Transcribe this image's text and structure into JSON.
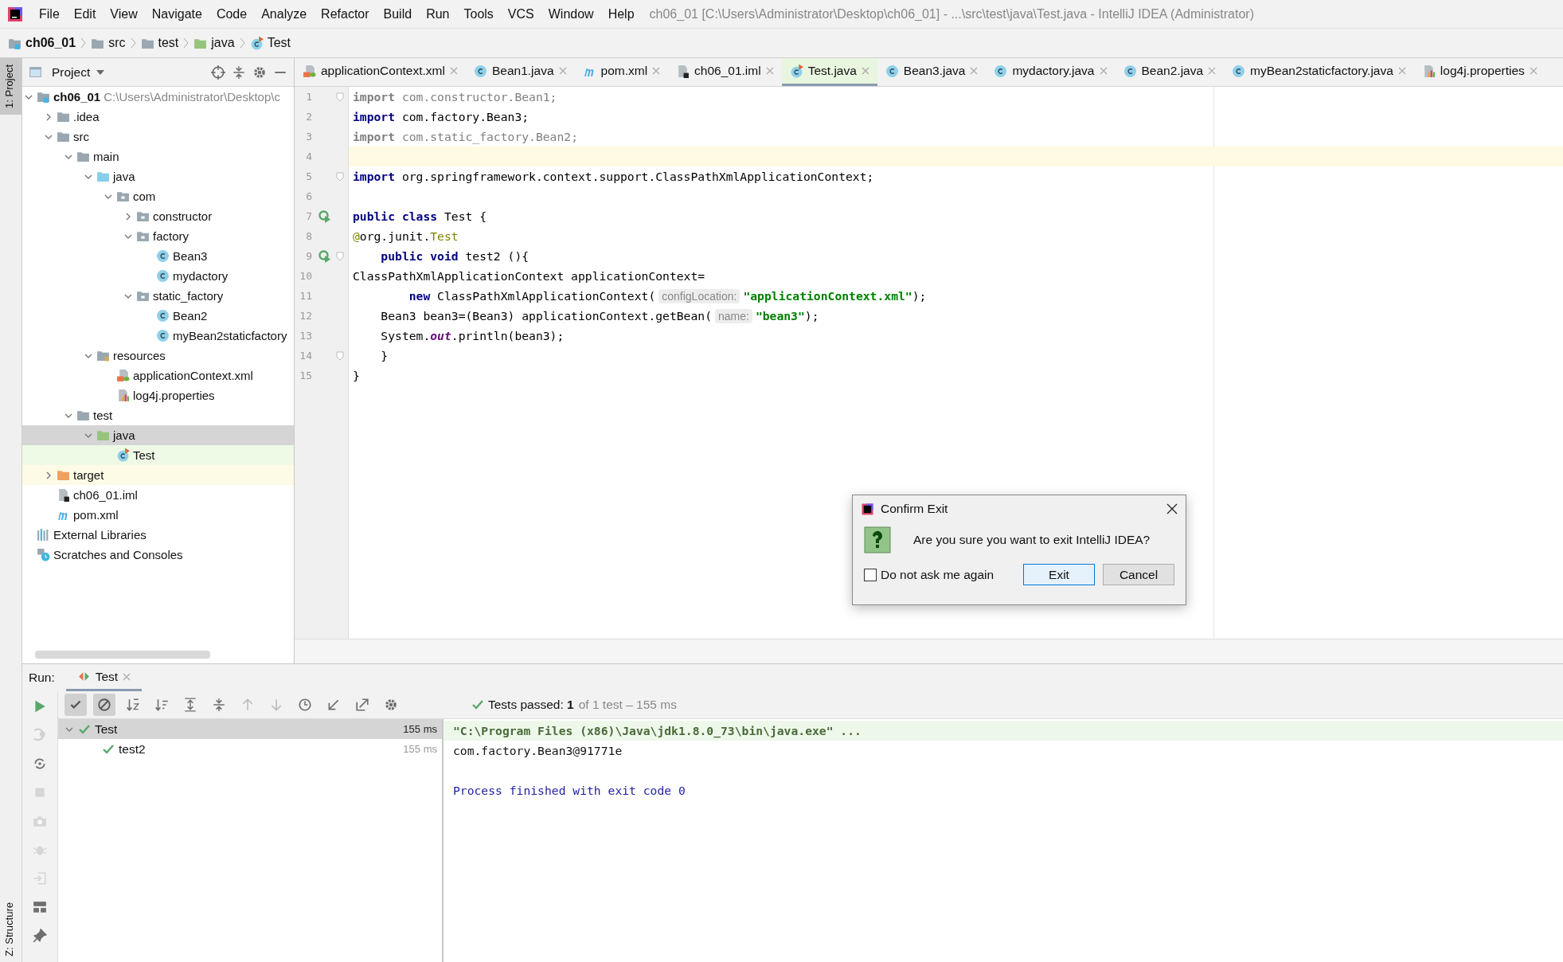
{
  "menu_bar": {
    "items": [
      "File",
      "Edit",
      "View",
      "Navigate",
      "Code",
      "Analyze",
      "Refactor",
      "Build",
      "Run",
      "Tools",
      "VCS",
      "Window",
      "Help"
    ],
    "title": "ch06_01 [C:\\Users\\Administrator\\Desktop\\ch06_01] - ...\\src\\test\\java\\Test.java - IntelliJ IDEA (Administrator)"
  },
  "breadcrumbs": [
    {
      "kind": "module",
      "label": "ch06_01"
    },
    {
      "kind": "folder",
      "label": "src"
    },
    {
      "kind": "folder",
      "label": "test"
    },
    {
      "kind": "test_folder",
      "label": "java"
    },
    {
      "kind": "test_class",
      "label": "Test"
    }
  ],
  "left_stripe": [
    {
      "label": "1: Project",
      "selected": true
    },
    {
      "label": "Z: Structure",
      "selected": false
    }
  ],
  "project_panel": {
    "title": "Project",
    "tree": [
      {
        "kind": "module",
        "name": "ch06_01",
        "path": "C:\\Users\\Administrator\\Desktop\\c",
        "selected": false,
        "expanded": true,
        "children": [
          {
            "kind": "folder",
            "name": ".idea",
            "selected": false,
            "expanded": false
          },
          {
            "kind": "folder",
            "name": "src",
            "selected": false,
            "expanded": true,
            "children": [
              {
                "kind": "folder",
                "name": "main",
                "selected": false,
                "expanded": true,
                "children": [
                  {
                    "kind": "src_folder",
                    "name": "java",
                    "selected": false,
                    "expanded": true,
                    "children": [
                      {
                        "kind": "package",
                        "name": "com",
                        "selected": false,
                        "expanded": true,
                        "children": [
                          {
                            "kind": "package",
                            "name": "constructor",
                            "selected": false,
                            "expanded": false
                          },
                          {
                            "kind": "package",
                            "name": "factory",
                            "selected": false,
                            "expanded": true,
                            "children": [
                              {
                                "kind": "class",
                                "name": "Bean3",
                                "selected": false
                              },
                              {
                                "kind": "class",
                                "name": "mydactory",
                                "selected": false
                              }
                            ]
                          },
                          {
                            "kind": "package",
                            "name": "static_factory",
                            "selected": false,
                            "expanded": true,
                            "children": [
                              {
                                "kind": "class",
                                "name": "Bean2",
                                "selected": false
                              },
                              {
                                "kind": "class",
                                "name": "myBean2staticfactory",
                                "selected": false
                              }
                            ]
                          }
                        ]
                      }
                    ]
                  },
                  {
                    "kind": "res_folder",
                    "name": "resources",
                    "selected": false,
                    "expanded": true,
                    "children": [
                      {
                        "kind": "xml",
                        "name": "applicationContext.xml",
                        "selected": false
                      },
                      {
                        "kind": "properties",
                        "name": "log4j.properties",
                        "selected": false
                      }
                    ]
                  }
                ]
              },
              {
                "kind": "folder",
                "name": "test",
                "selected": false,
                "expanded": true,
                "children": [
                  {
                    "kind": "test_folder",
                    "name": "java",
                    "selected": true,
                    "expanded": true,
                    "children": [
                      {
                        "kind": "test_class",
                        "name": "Test",
                        "selected": false
                      }
                    ]
                  }
                ]
              }
            ]
          },
          {
            "kind": "excluded_folder",
            "name": "target",
            "selected": false,
            "expanded": false
          },
          {
            "kind": "iml",
            "name": "ch06_01.iml",
            "selected": false
          },
          {
            "kind": "maven",
            "name": "pom.xml",
            "selected": false
          }
        ]
      },
      {
        "kind": "libraries",
        "name": "External Libraries",
        "selected": false
      },
      {
        "kind": "scratches",
        "name": "Scratches and Consoles",
        "selected": false
      }
    ]
  },
  "editor_tabs": [
    {
      "kind": "xml",
      "label": "applicationContext.xml",
      "selected": false
    },
    {
      "kind": "class",
      "label": "Bean1.java",
      "selected": false
    },
    {
      "kind": "maven",
      "label": "pom.xml",
      "selected": false
    },
    {
      "kind": "iml",
      "label": "ch06_01.iml",
      "selected": false
    },
    {
      "kind": "test_class",
      "label": "Test.java",
      "selected": true
    },
    {
      "kind": "class",
      "label": "Bean3.java",
      "selected": false
    },
    {
      "kind": "class",
      "label": "mydactory.java",
      "selected": false
    },
    {
      "kind": "class",
      "label": "Bean2.java",
      "selected": false
    },
    {
      "kind": "class",
      "label": "myBean2staticfactory.java",
      "selected": false
    },
    {
      "kind": "properties",
      "label": "log4j.properties",
      "selected": false
    }
  ],
  "editor": {
    "lines": [
      {
        "number": "1",
        "fold": true,
        "runnable": false,
        "current": false,
        "tokens": [
          {
            "kind": "unused_kw",
            "t": "import"
          },
          {
            "kind": "unused",
            "t": " com.constructor.Bean1;"
          }
        ]
      },
      {
        "number": "2",
        "fold": false,
        "runnable": false,
        "current": false,
        "tokens": [
          {
            "kind": "kw",
            "t": "import"
          },
          {
            "kind": "plain",
            "t": " com.factory.Bean3;"
          }
        ]
      },
      {
        "number": "3",
        "fold": false,
        "runnable": false,
        "current": false,
        "tokens": [
          {
            "kind": "unused_kw",
            "t": "import"
          },
          {
            "kind": "unused",
            "t": " com.static_factory.Bean2;"
          }
        ]
      },
      {
        "number": "4",
        "fold": false,
        "runnable": false,
        "current": true
      },
      {
        "number": "5",
        "fold": true,
        "runnable": false,
        "current": false,
        "tokens": [
          {
            "kind": "kw",
            "t": "import"
          },
          {
            "kind": "plain",
            "t": " org.springframework.context.support.ClassPathXmlApplicationContext;"
          }
        ]
      },
      {
        "number": "6",
        "fold": false,
        "runnable": false,
        "current": false
      },
      {
        "number": "7",
        "fold": false,
        "runnable": true,
        "current": false,
        "tokens": [
          {
            "kind": "kw",
            "t": "public class"
          },
          {
            "kind": "plain",
            "t": " Test {"
          }
        ]
      },
      {
        "number": "8",
        "fold": false,
        "runnable": false,
        "current": false,
        "tokens": [
          {
            "kind": "ann",
            "t": "@"
          },
          {
            "kind": "plain",
            "t": "org.junit."
          },
          {
            "kind": "ann",
            "t": "Test"
          }
        ]
      },
      {
        "number": "9",
        "fold": true,
        "runnable": true,
        "current": false,
        "tokens": [
          {
            "kind": "kw",
            "t": "    public void"
          },
          {
            "kind": "plain",
            "t": " test2 (){"
          }
        ]
      },
      {
        "number": "10",
        "fold": false,
        "runnable": false,
        "current": false,
        "tokens": [
          {
            "kind": "plain",
            "t": "ClassPathXmlApplicationContext applicationContext="
          }
        ]
      },
      {
        "number": "11",
        "fold": false,
        "runnable": false,
        "current": false,
        "tokens": [
          {
            "kind": "kw",
            "t": "        new"
          },
          {
            "kind": "plain",
            "t": " ClassPathXmlApplicationContext("
          },
          {
            "kind": "hint",
            "t": "configLocation:"
          },
          {
            "kind": "str",
            "t": "\"applicationContext.xml\""
          },
          {
            "kind": "plain",
            "t": ");"
          }
        ]
      },
      {
        "number": "12",
        "fold": false,
        "runnable": false,
        "current": false,
        "tokens": [
          {
            "kind": "plain",
            "t": "    Bean3 bean3=(Bean3) applicationContext.getBean("
          },
          {
            "kind": "hint",
            "t": "name:"
          },
          {
            "kind": "str",
            "t": "\"bean3\""
          },
          {
            "kind": "plain",
            "t": ");"
          }
        ]
      },
      {
        "number": "13",
        "fold": false,
        "runnable": false,
        "current": false,
        "tokens": [
          {
            "kind": "plain",
            "t": "    System."
          },
          {
            "kind": "field",
            "t": "out"
          },
          {
            "kind": "plain",
            "t": ".println(bean3);"
          }
        ]
      },
      {
        "number": "14",
        "fold": true,
        "runnable": false,
        "current": false,
        "tokens": [
          {
            "kind": "plain",
            "t": "    }"
          }
        ]
      },
      {
        "number": "15",
        "fold": false,
        "runnable": false,
        "current": false,
        "tokens": [
          {
            "kind": "plain",
            "t": "}"
          }
        ]
      }
    ]
  },
  "run_panel": {
    "label": "Run:",
    "tabs": [
      {
        "label": "Test",
        "selected": true
      }
    ],
    "side_tools": [
      {
        "kind": "run",
        "disabled": false
      },
      {
        "kind": "rerun_failed",
        "disabled": true
      },
      {
        "kind": "autotest",
        "disabled": false
      },
      {
        "kind": "stop",
        "disabled": true
      },
      {
        "kind": "camera",
        "disabled": true
      },
      {
        "kind": "bug",
        "disabled": true
      },
      {
        "kind": "exit",
        "disabled": true
      },
      {
        "kind": "layout",
        "disabled": false
      },
      {
        "kind": "pin",
        "disabled": false
      }
    ],
    "toolbar": [
      {
        "kind": "check",
        "toggled": true
      },
      {
        "kind": "ban",
        "toggled": true
      },
      {
        "kind": "sort_alpha",
        "toggled": false
      },
      {
        "kind": "sort_time",
        "toggled": false
      },
      {
        "kind": "expand",
        "toggled": false
      },
      {
        "kind": "collapse",
        "toggled": false
      },
      {
        "kind": "up",
        "toggled": false
      },
      {
        "kind": "down",
        "toggled": false
      },
      {
        "kind": "history",
        "toggled": false
      },
      {
        "kind": "import",
        "toggled": false
      },
      {
        "kind": "export",
        "toggled": false
      },
      {
        "kind": "gear",
        "toggled": false
      }
    ],
    "status": {
      "summary": "Tests passed: **1**",
      "detail": "of 1 test – 155 ms"
    },
    "tests": [
      {
        "name": "Test",
        "time": "155 ms",
        "selected": true,
        "expanded": true,
        "children": [
          {
            "name": "test2",
            "time": "155 ms",
            "selected": false
          }
        ]
      }
    ],
    "console": [
      {
        "kind": "command",
        "text": "\"C:\\Program Files (x86)\\Java\\jdk1.8.0_73\\bin\\java.exe\" ..."
      },
      {
        "kind": "output",
        "text": "com.factory.Bean3@91771e"
      },
      {
        "kind": "blank"
      },
      {
        "kind": "exit",
        "text": "Process finished with exit code 0"
      }
    ]
  },
  "dialog": {
    "title": "Confirm Exit",
    "message": "Are you sure you want to exit IntelliJ IDEA?",
    "checkbox": {
      "label": "Do not ask me again",
      "checked": false
    },
    "buttons": [
      {
        "label": "Exit",
        "default": true
      },
      {
        "label": "Cancel",
        "default": false
      }
    ]
  }
}
